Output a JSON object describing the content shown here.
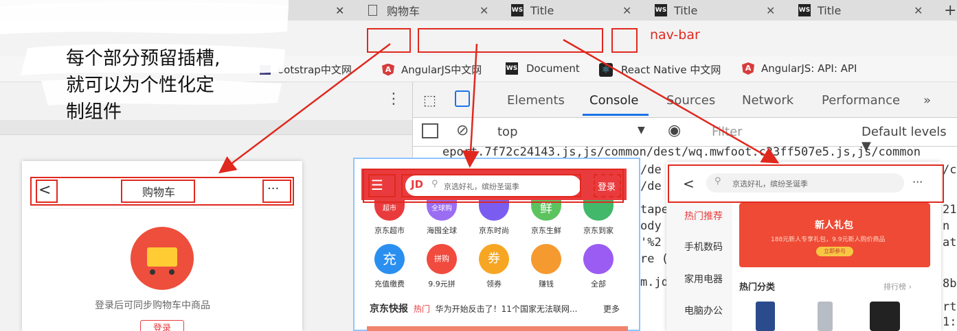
{
  "tabs": [
    {
      "label": "购物车"
    },
    {
      "label": "Title"
    },
    {
      "label": "Title"
    },
    {
      "label": "Title"
    }
  ],
  "bookmarks": [
    {
      "label": "ootstrap中文网"
    },
    {
      "label": "AngularJS中文网"
    },
    {
      "label": "Document"
    },
    {
      "label": "React Native 中文网"
    },
    {
      "label": "AngularJS: API: API"
    }
  ],
  "annotation": {
    "line1": "每个部分预留插槽,",
    "line2": "就可以为个性化定",
    "line3": "制组件"
  },
  "navbar_label": "nav-bar",
  "devtools": {
    "tabs": [
      "Elements",
      "Console",
      "Sources",
      "Network",
      "Performance"
    ],
    "more": "»",
    "context": "top",
    "filter_placeholder": "Filter",
    "levels": "Default levels ▼",
    "code_line1": "eport.7f72c24143.js,js/common/dest/wq.mwfoot.c23ff507e5.js,js/common",
    "frag_a": "/de",
    "frag_b": "/de",
    "frag_c": "tape",
    "frag_d": "ody",
    "frag_e": "'%2",
    "frag_f": "re (",
    "frag_g": "m.jd",
    "right_a": "/c",
    "right_b": "21",
    "right_c": "n M",
    "right_d": "atu",
    "right_e": "8b",
    "right_f": "rt",
    "right_g": "1:"
  },
  "phone1": {
    "title": "购物车",
    "back": "<",
    "more": "···",
    "message": "登录后可同步购物车中商品",
    "login": "登录"
  },
  "phone2": {
    "logo": "JD",
    "search": "京选好礼，缤纷圣诞季",
    "login": "登录",
    "row1": [
      "京东超市",
      "海囤全球",
      "京东时尚",
      "京东生鲜",
      "京东到家"
    ],
    "row2": [
      "充值缴费",
      "9.9元拼",
      "领券",
      "赚钱",
      "全部"
    ],
    "row1_glyphs": [
      "超市",
      "全球购",
      "",
      "鲜",
      ""
    ],
    "row2_glyphs": [
      "充",
      "拼购",
      "券",
      "",
      ""
    ],
    "news_brand": "京东快报",
    "news_tag": "热门",
    "news_text": "华为开始反击了！11个国家无法联网...",
    "news_more": "更多"
  },
  "phone3": {
    "back": "<",
    "search": "京选好礼，缤纷圣诞季",
    "more": "···",
    "sidebar": [
      "热门推荐",
      "手机数码",
      "家用电器",
      "电脑办公"
    ],
    "banner_title": "新人礼包",
    "banner_sub": "188元新人专享礼包，9.9元新人购价商品",
    "banner_btn": "立即参与",
    "hot_title": "热门分类",
    "rank": "排行榜 ›"
  },
  "colors": {
    "red": "#e0281e",
    "jd_red": "#e93b3d"
  }
}
